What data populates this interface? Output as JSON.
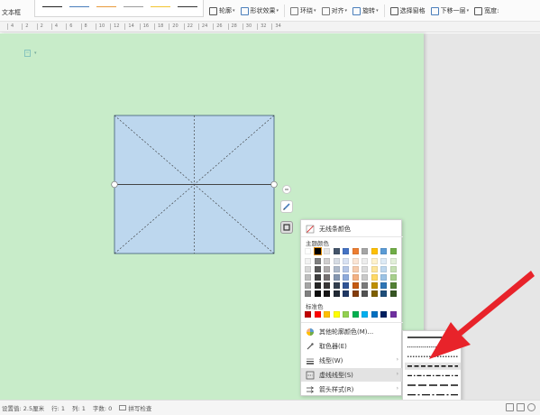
{
  "toolbar": {
    "left_label": "文本框",
    "items": [
      {
        "label": "轮廓",
        "has_dropdown": true
      },
      {
        "label": "形状效果",
        "has_dropdown": true
      },
      {
        "label": "环绕",
        "has_dropdown": true
      },
      {
        "label": "对齐",
        "has_dropdown": true
      },
      {
        "label": "旋转",
        "has_dropdown": true
      },
      {
        "label": "选择窗格",
        "has_dropdown": false
      },
      {
        "label": "下移一层",
        "has_dropdown": true
      },
      {
        "label": "宽度:",
        "has_dropdown": false
      }
    ],
    "line_swatch_colors": [
      "#222222",
      "#4a7ebb",
      "#e89a3c",
      "#9c9c9c",
      "#f2c431",
      "#333333"
    ]
  },
  "ruler": {
    "numbers": [
      "4",
      "2",
      "2",
      "4",
      "6",
      "8",
      "10",
      "12",
      "14",
      "16",
      "18",
      "20",
      "22",
      "24",
      "26",
      "28",
      "30",
      "32",
      "34"
    ]
  },
  "outline_menu": {
    "no_line_color": "无线条颜色",
    "theme_colors_header": "主题颜色",
    "standard_colors_header": "标准色",
    "more_colors": "其他轮廓颜色(M)...",
    "eyedropper": "取色器(E)",
    "line_style": "线型(W)",
    "dash_style": "虚线线型(S)",
    "arrow_style": "箭头样式(R)",
    "theme_colors_top": [
      "#ffffff",
      "#000000",
      "#e7e6e6",
      "#44546a",
      "#4472c4",
      "#ed7d31",
      "#a5a5a5",
      "#ffc000",
      "#5b9bd5",
      "#70ad47"
    ],
    "theme_colors_shades": [
      [
        "#f2f2f2",
        "#7f7f7f",
        "#d0cece",
        "#d6dce4",
        "#d9e2f3",
        "#fbe5d5",
        "#ededed",
        "#fff2cc",
        "#deebf6",
        "#e2efd9"
      ],
      [
        "#d8d8d8",
        "#595959",
        "#aeabab",
        "#adb9ca",
        "#b4c6e7",
        "#f7cbac",
        "#dbdbdb",
        "#fee599",
        "#bdd7ee",
        "#c5e0b3"
      ],
      [
        "#bfbfbf",
        "#3f3f3f",
        "#757070",
        "#8496b0",
        "#8eaadb",
        "#f4b183",
        "#c9c9c9",
        "#ffd965",
        "#9cc3e5",
        "#a8d08d"
      ],
      [
        "#a5a5a5",
        "#262626",
        "#3a3838",
        "#323f4f",
        "#2f5496",
        "#c55a11",
        "#7b7b7b",
        "#bf9000",
        "#2e75b5",
        "#538135"
      ],
      [
        "#7f7f7f",
        "#0c0c0c",
        "#171616",
        "#222a35",
        "#1f3864",
        "#833c0b",
        "#525252",
        "#7f6000",
        "#1e4e79",
        "#375623"
      ]
    ],
    "standard_colors": [
      "#c00000",
      "#ff0000",
      "#ffc000",
      "#ffff00",
      "#92d050",
      "#00b050",
      "#00b0f0",
      "#0070c0",
      "#002060",
      "#7030a0"
    ]
  },
  "dash_submenu": {
    "styles": [
      "solid",
      "round-dot",
      "square-dot",
      "dash",
      "dash-dot",
      "long-dash",
      "long-dash-dot",
      "long-dash-dot-dot"
    ]
  },
  "status_bar": {
    "position": "设置值: 2.5厘米",
    "line": "行: 1",
    "column": "列: 1",
    "word_count": "字数: 0",
    "spell_check": "拼写检查"
  },
  "colors": {
    "page_bg": "#c8ecc9",
    "shape_fill": "#bdd7ee",
    "arrow": "#e8232a"
  }
}
